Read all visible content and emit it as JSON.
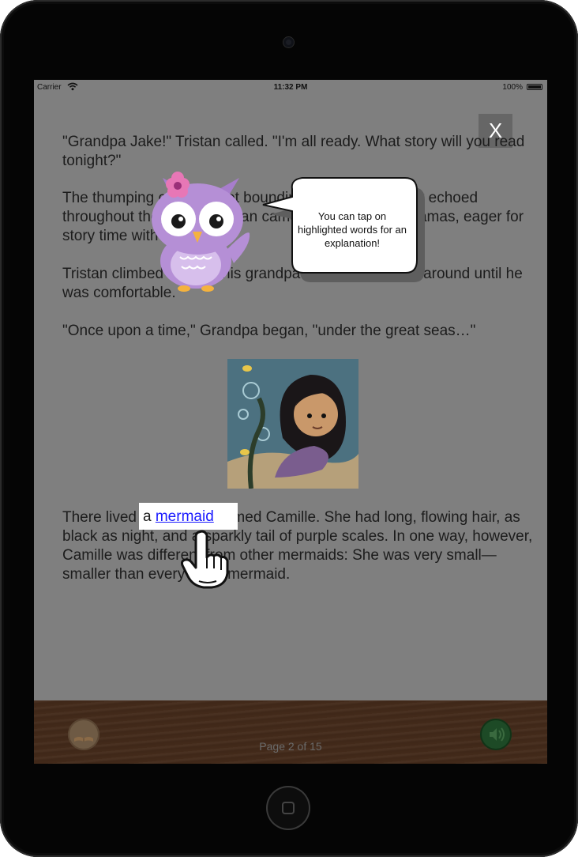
{
  "status_bar": {
    "carrier": "Carrier",
    "time": "11:32 PM",
    "battery": "100%"
  },
  "close_label": "X",
  "story": {
    "paragraphs": [
      "\"Grandpa Jake!\" Tristan called. \"I'm all ready. What story will you read tonight?\"",
      "The thumping of small feet bounding down the hallway echoed throughout the house. Tristan came in wearing his pajamas, eager for story time with Grandpa.",
      "Tristan climbed up onto his grandpa's lap and wiggled around until he was comfortable.",
      "\"Once upon a time,\" Grandpa began, \"under the great seas…\"",
      "There lived a mermaid named Camille. She had long, flowing hair, as black as night, and a sparkly tail of purple scales. In one way, however, Camille was different from other mermaids: She was very small—smaller than every other mermaid."
    ],
    "highlight": {
      "prefix": "a ",
      "word": "mermaid"
    }
  },
  "tutorial": {
    "bubble_text": "You can tap on highlighted words for an explanation!"
  },
  "footer": {
    "page_label": "Page 2 of 15"
  },
  "colors": {
    "overlay": "#7f7f7f",
    "link": "#1a1aff",
    "wood": "#432a1a",
    "owl": "#b58fd6",
    "flower": "#e777b6"
  },
  "icons": [
    "wifi-icon",
    "battery-icon",
    "owl-mascot",
    "pointing-hand-icon",
    "book-icon",
    "speaker-icon",
    "flower-icon",
    "fish-icon"
  ]
}
